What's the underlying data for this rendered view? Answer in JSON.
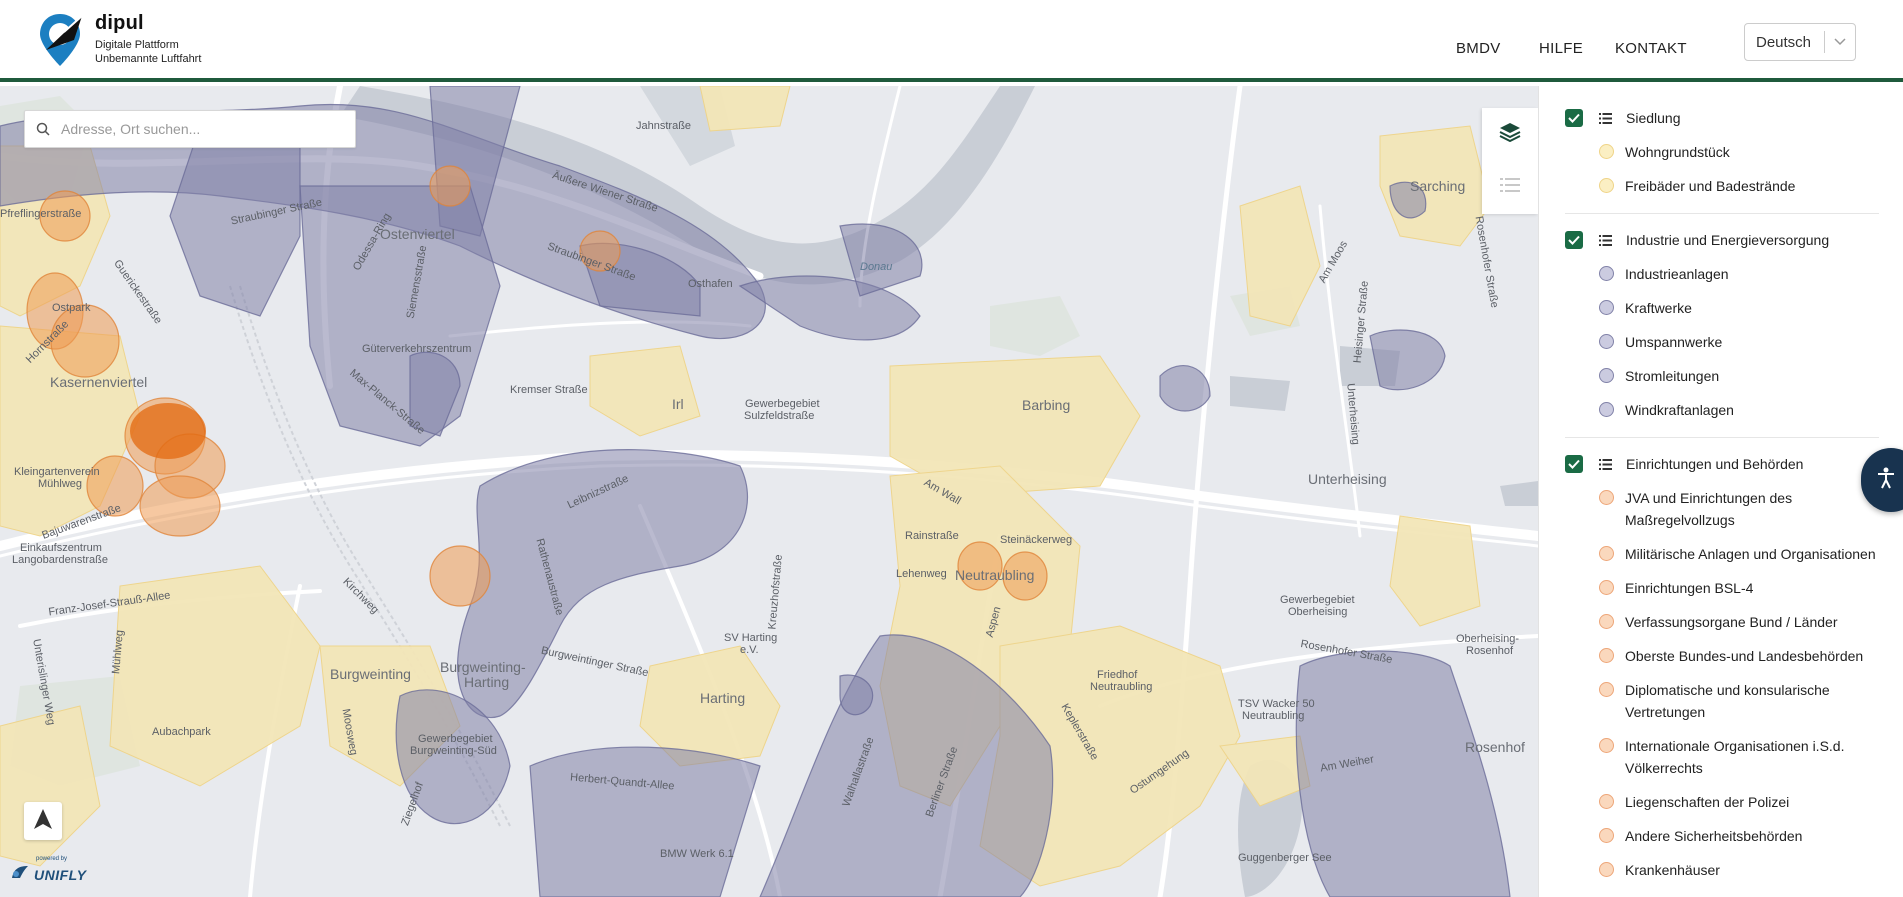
{
  "header": {
    "brand_title": "dipul",
    "brand_sub_1": "Digitale Plattform",
    "brand_sub_2": "Unbemannte Luftfahrt",
    "nav": [
      "BMDV",
      "HILFE",
      "KONTAKT"
    ],
    "language": "Deutsch"
  },
  "map": {
    "search_placeholder": "Adresse, Ort suchen...",
    "attribution": {
      "small": "powered by",
      "brand": "UNIFLY"
    },
    "labels": {
      "jahnstrasse": "Jahnstraße",
      "aussere_wiener": "Äußere Wiener Straße",
      "straubinger_1": "Straubinger Straße",
      "straubinger_2": "Straubinger Straße",
      "odessa": "Odessa-Ring",
      "ostenviertel": "Ostenviertel",
      "siemensstrasse": "Siemensstraße",
      "osthafen": "Osthafen",
      "donau": "Donau",
      "reflinger": "Pfreflingerstraße",
      "ostpark": "Ostpark",
      "guericke": "Guerickestraße",
      "hornstrasse": "Hornstraße",
      "kasernenviertel": "Kasernenviertel",
      "gueterverkehrszentrum": "Güterverkehrszentrum",
      "kremser": "Kremser Straße",
      "irl": "Irl",
      "gewerbegebiet_sulz_1": "Gewerbegebiet",
      "gewerbegebiet_sulz_2": "Sulzfeldstraße",
      "max_planck": "Max-Planck-Straße",
      "barbing": "Barbing",
      "kleingartenverein_1": "Kleingartenverein",
      "kleingartenverein_2": "Mühlweg",
      "bajuwaren": "Bajuwarenstraße",
      "leibnizstrasse": "Leibnizstraße",
      "unterheising": "Unterheising",
      "am_wall": "Am Wall",
      "rainstrasse": "Rainstraße",
      "steinaeckerweg": "Steinäckerweg",
      "lehenweg": "Lehenweg",
      "neutraubling": "Neutraubling",
      "einkaufszentrum_1": "Einkaufszentrum",
      "einkaufszentrum_2": "Langobardenstraße",
      "franz_josef": "Franz-Josef-Strauß-Allee",
      "rathenau": "Rathenaustraße",
      "kreuzhof": "Kreuzhofstraße",
      "sv_harting_1": "SV Harting",
      "sv_harting_2": "e.V.",
      "gewerbegebiet_ober_1": "Gewerbegebiet",
      "gewerbegebiet_ober_2": "Oberheising",
      "oberheising_rosenhof_1": "Oberheising-",
      "oberheising_rosenhof_2": "Rosenhof",
      "unterislinger": "Unterislinger Weg",
      "burgweinting": "Burgweinting",
      "burgweinting_harting_1": "Burgweinting-",
      "burgweinting_harting_2": "Harting",
      "burgweintinger_str": "Burgweintinger Straße",
      "harting": "Harting",
      "friedhof_1": "Friedhof",
      "friedhof_2": "Neutraubling",
      "rosenhofer": "Rosenhofer Straße",
      "tsv_1": "TSV Wacker 50",
      "tsv_2": "Neutraubling",
      "aubachpark": "Aubachpark",
      "gewerbegebiet_bw_1": "Gewerbegebiet",
      "gewerbegebiet_bw_2": "Burgweinting-Süd",
      "herbert_quandt": "Herbert-Quandt-Allee",
      "walhalla": "Walhallastraße",
      "berliner": "Berliner Straße",
      "rosenhof": "Rosenhof",
      "am_weiher": "Am Weiher",
      "ostumgehung": "Ostumgehung",
      "bmw": "BMW Werk 6.1",
      "guggenberger": "Guggenberger See",
      "sarching": "Sarching",
      "am_moos": "Am Moos",
      "heisinger": "Heisinger Straße",
      "rosenhofer_2": "Rosenhofer Straße",
      "unterheising_str": "Unterheising",
      "ziegelhof": "Ziegelhof",
      "moosweg": "Moosweg",
      "muehlweg": "Mühlweg",
      "kirchweg": "Kirchweg",
      "kepler": "Keplerstraße",
      "aspen": "Aspen"
    }
  },
  "panel": {
    "groups": [
      {
        "label": "Siedlung",
        "items": [
          "Wohngrundstück",
          "Freibäder und Badestrände"
        ]
      },
      {
        "label": "Industrie und Energieversorgung",
        "items": [
          "Industrieanlagen",
          "Kraftwerke",
          "Umspannwerke",
          "Stromleitungen",
          "Windkraftanlagen"
        ]
      },
      {
        "label": "Einrichtungen und Behörden",
        "items": [
          "JVA und Einrichtungen des Maßregelvollzugs",
          "Militärische Anlagen und Organisationen",
          "Einrichtungen BSL-4",
          "Verfassungsorgane Bund / Länder",
          "Oberste Bundes-und Landesbehörden",
          "Diplomatische und konsularische Vertretungen",
          "Internationale Organisationen i.S.d. Völkerrechts",
          "Liegenschaften der Polizei",
          "Andere Sicherheitsbehörden",
          "Krankenhäuser"
        ]
      }
    ]
  },
  "colors": {
    "header_border": "#1f5a3c",
    "checkbox": "#1a6b45",
    "zone_purple": "#8182a8",
    "zone_orange": "#eda679",
    "zone_yellow": "#efd488",
    "water": "#c9ced6"
  }
}
